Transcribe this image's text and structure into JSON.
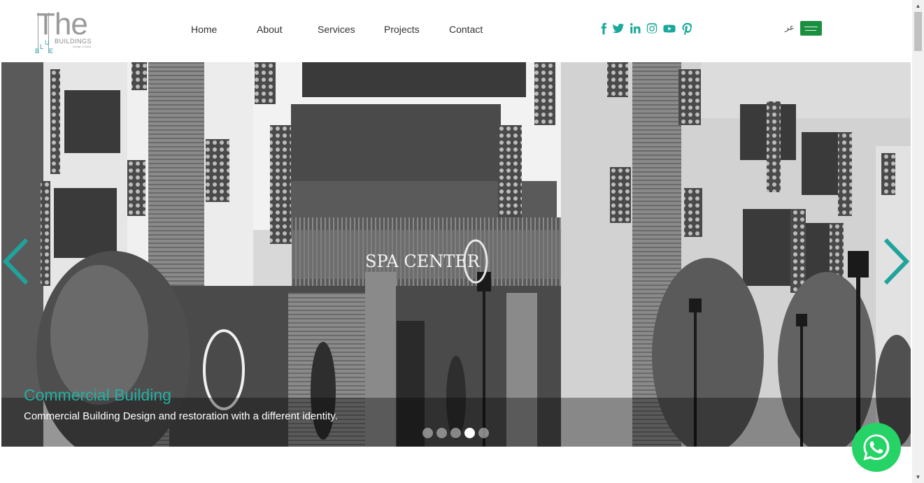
{
  "logo": {
    "main_text": "The",
    "sub_text": "BUILDINGS",
    "tagline": "Design & Build",
    "blue_letters": [
      "B",
      "L",
      "U",
      "E"
    ]
  },
  "nav": {
    "items": [
      {
        "label": "Home"
      },
      {
        "label": "About"
      },
      {
        "label": "Services"
      },
      {
        "label": "Projects"
      },
      {
        "label": "Contact"
      }
    ]
  },
  "social": {
    "icons": [
      "facebook-icon",
      "twitter-icon",
      "linkedin-icon",
      "instagram-icon",
      "youtube-icon",
      "pinterest-icon"
    ],
    "color": "#1aa89a"
  },
  "language": {
    "label": "عر",
    "flag": "saudi-arabia-flag-icon"
  },
  "slider": {
    "title": "Commercial Building",
    "description": "Commercial Building Design and restoration with a different identity.",
    "sign_text": "SPA CENTER",
    "total_slides": 5,
    "active_slide": 4,
    "accent_color": "#22b0a2"
  },
  "whatsapp": {
    "icon": "whatsapp-icon",
    "color": "#25d366"
  }
}
